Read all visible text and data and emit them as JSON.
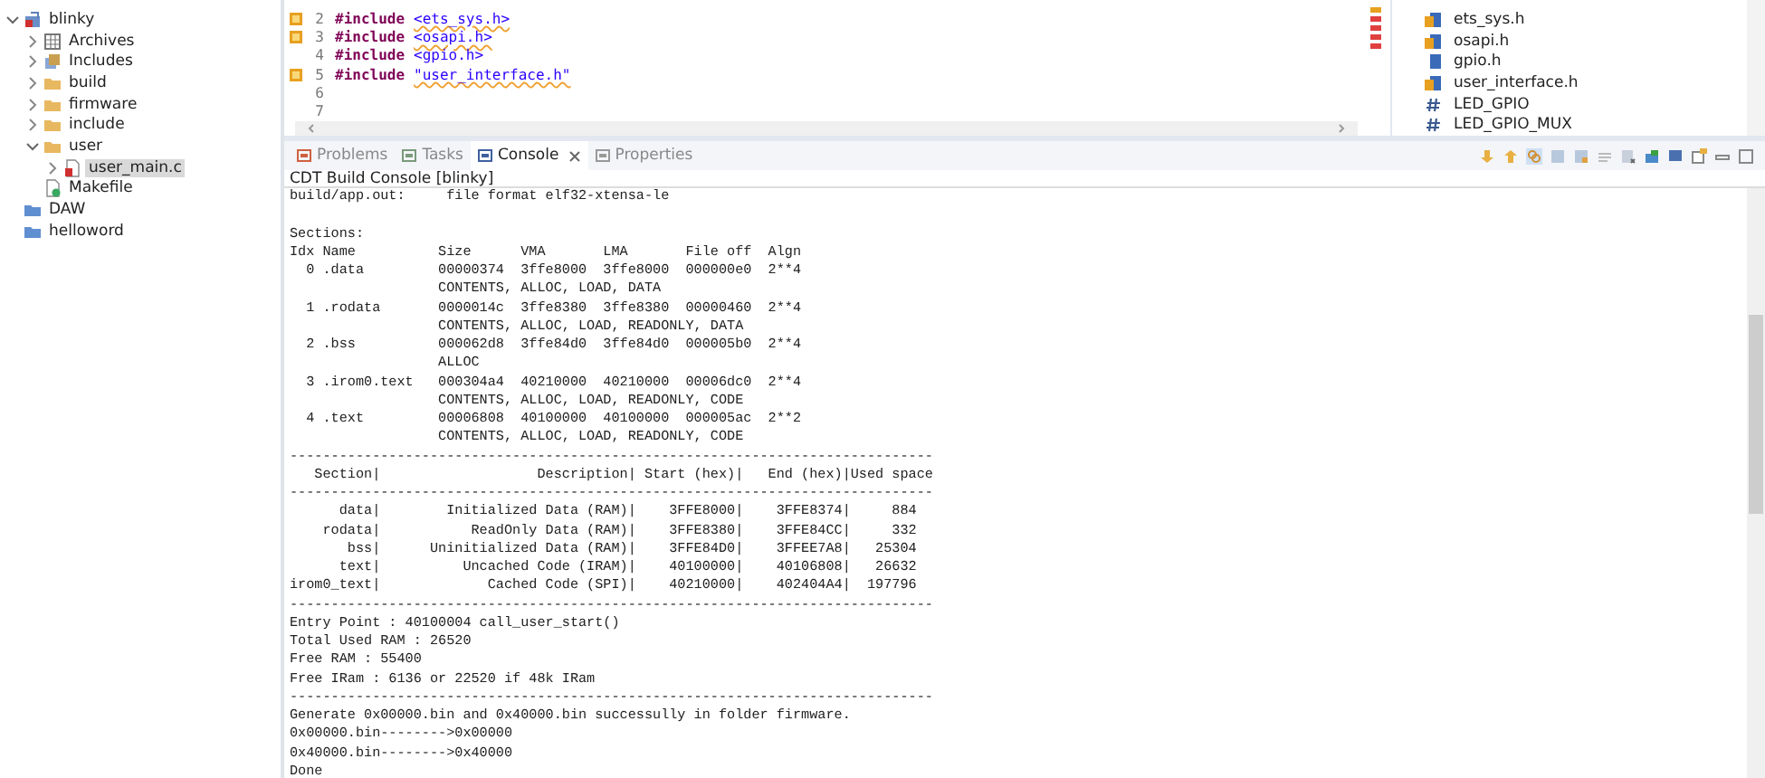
{
  "project_explorer": {
    "items": [
      {
        "label": "blinky",
        "kind": "project",
        "expandable": true,
        "expanded": true,
        "selected": false,
        "children": [
          {
            "label": "Archives",
            "kind": "archives",
            "expandable": true,
            "expanded": false,
            "selected": false
          },
          {
            "label": "Includes",
            "kind": "includes",
            "expandable": true,
            "expanded": false,
            "selected": false
          },
          {
            "label": "build",
            "kind": "folder",
            "expandable": true,
            "expanded": false,
            "selected": false
          },
          {
            "label": "firmware",
            "kind": "folder",
            "expandable": true,
            "expanded": false,
            "selected": false
          },
          {
            "label": "include",
            "kind": "folder",
            "expandable": true,
            "expanded": false,
            "selected": false
          },
          {
            "label": "user",
            "kind": "folder",
            "expandable": true,
            "expanded": true,
            "selected": false,
            "children": [
              {
                "label": "user_main.c",
                "kind": "cfile",
                "expandable": true,
                "expanded": false,
                "selected": true
              }
            ]
          },
          {
            "label": "Makefile",
            "kind": "makefile",
            "expandable": false,
            "selected": false
          }
        ]
      },
      {
        "label": "DAW",
        "kind": "closed_project",
        "expandable": false,
        "selected": false
      },
      {
        "label": "helloword",
        "kind": "closed_project",
        "expandable": false,
        "selected": false
      }
    ]
  },
  "editor": {
    "lines": [
      {
        "number": "2",
        "warning": true,
        "directive": "#include",
        "target": "<ets_sys.h>"
      },
      {
        "number": "3",
        "warning": true,
        "directive": "#include",
        "target": "<osapi.h>"
      },
      {
        "number": "4",
        "warning": false,
        "directive": "#include",
        "target": "<gpio.h>"
      },
      {
        "number": "5",
        "warning": true,
        "directive": "#include",
        "target": "\"user_interface.h\""
      },
      {
        "number": "6",
        "warning": false
      },
      {
        "number": "7",
        "warning": false
      }
    ]
  },
  "outline": {
    "items": [
      {
        "label": "ets_sys.h",
        "kind": "include",
        "warning": true
      },
      {
        "label": "osapi.h",
        "kind": "include",
        "warning": true
      },
      {
        "label": "gpio.h",
        "kind": "include",
        "warning": false
      },
      {
        "label": "user_interface.h",
        "kind": "include",
        "warning": true
      },
      {
        "label": "LED_GPIO",
        "kind": "macro",
        "warning": false
      },
      {
        "label": "LED_GPIO_MUX",
        "kind": "macro",
        "warning": false
      }
    ]
  },
  "console": {
    "tabs": [
      {
        "label": "Problems",
        "kind": "problems",
        "selected": false
      },
      {
        "label": "Tasks",
        "kind": "tasks",
        "selected": false
      },
      {
        "label": "Console",
        "kind": "console",
        "selected": true
      },
      {
        "label": "Properties",
        "kind": "properties",
        "selected": false
      }
    ],
    "title": "CDT Build Console [blinky]",
    "lines": [
      {
        "text": "build/app.out:     file format elf32-xtensa-le",
        "gap_before": false
      },
      {
        "text": "Sections:",
        "gap_before": true
      },
      {
        "text": "Idx Name          Size      VMA       LMA       File off  Algn",
        "gap_before": false
      },
      {
        "text": "  0 .data         00000374  3ffe8000  3ffe8000  000000e0  2**4",
        "gap_before": false
      },
      {
        "text": "                  CONTENTS, ALLOC, LOAD, DATA",
        "gap_before": false
      },
      {
        "text": "  1 .rodata       0000014c  3ffe8380  3ffe8380  00000460  2**4",
        "gap_before": false
      },
      {
        "text": "                  CONTENTS, ALLOC, LOAD, READONLY, DATA",
        "gap_before": false
      },
      {
        "text": "  2 .bss          000062d8  3ffe84d0  3ffe84d0  000005b0  2**4",
        "gap_before": false
      },
      {
        "text": "                  ALLOC",
        "gap_before": false
      },
      {
        "text": "  3 .irom0.text   000304a4  40210000  40210000  00006dc0  2**4",
        "gap_before": false
      },
      {
        "text": "                  CONTENTS, ALLOC, LOAD, READONLY, CODE",
        "gap_before": false
      },
      {
        "text": "  4 .text         00006808  40100000  40100000  000005ac  2**2",
        "gap_before": false
      },
      {
        "text": "                  CONTENTS, ALLOC, LOAD, READONLY, CODE",
        "gap_before": false
      },
      {
        "text": "------------------------------------------------------------------------------",
        "gap_before": false
      },
      {
        "text": "   Section|                   Description| Start (hex)|   End (hex)|Used space",
        "gap_before": false
      },
      {
        "text": "------------------------------------------------------------------------------",
        "gap_before": false
      },
      {
        "text": "      data|        Initialized Data (RAM)|    3FFE8000|    3FFE8374|     884",
        "gap_before": false
      },
      {
        "text": "    rodata|           ReadOnly Data (RAM)|    3FFE8380|    3FFE84CC|     332",
        "gap_before": false
      },
      {
        "text": "       bss|      Uninitialized Data (RAM)|    3FFE84D0|    3FFEE7A8|   25304",
        "gap_before": false
      },
      {
        "text": "      text|          Uncached Code (IRAM)|    40100000|    40106808|   26632",
        "gap_before": false
      },
      {
        "text": "irom0_text|             Cached Code (SPI)|    40210000|    402404A4|  197796",
        "gap_before": false
      },
      {
        "text": "------------------------------------------------------------------------------",
        "gap_before": false
      },
      {
        "text": "Entry Point : 40100004 call_user_start()",
        "gap_before": false
      },
      {
        "text": "Total Used RAM : 26520",
        "gap_before": false
      },
      {
        "text": "Free RAM : 55400",
        "gap_before": false
      },
      {
        "text": "Free IRam : 6136 or 22520 if 48k IRam",
        "gap_before": false
      },
      {
        "text": "------------------------------------------------------------------------------",
        "gap_before": false
      },
      {
        "text": "Generate 0x00000.bin and 0x40000.bin successully in folder firmware.",
        "gap_before": false
      },
      {
        "text": "0x00000.bin-------->0x00000",
        "gap_before": false
      },
      {
        "text": "0x40000.bin-------->0x40000",
        "gap_before": false
      },
      {
        "text": "Done",
        "gap_before": false
      }
    ]
  }
}
